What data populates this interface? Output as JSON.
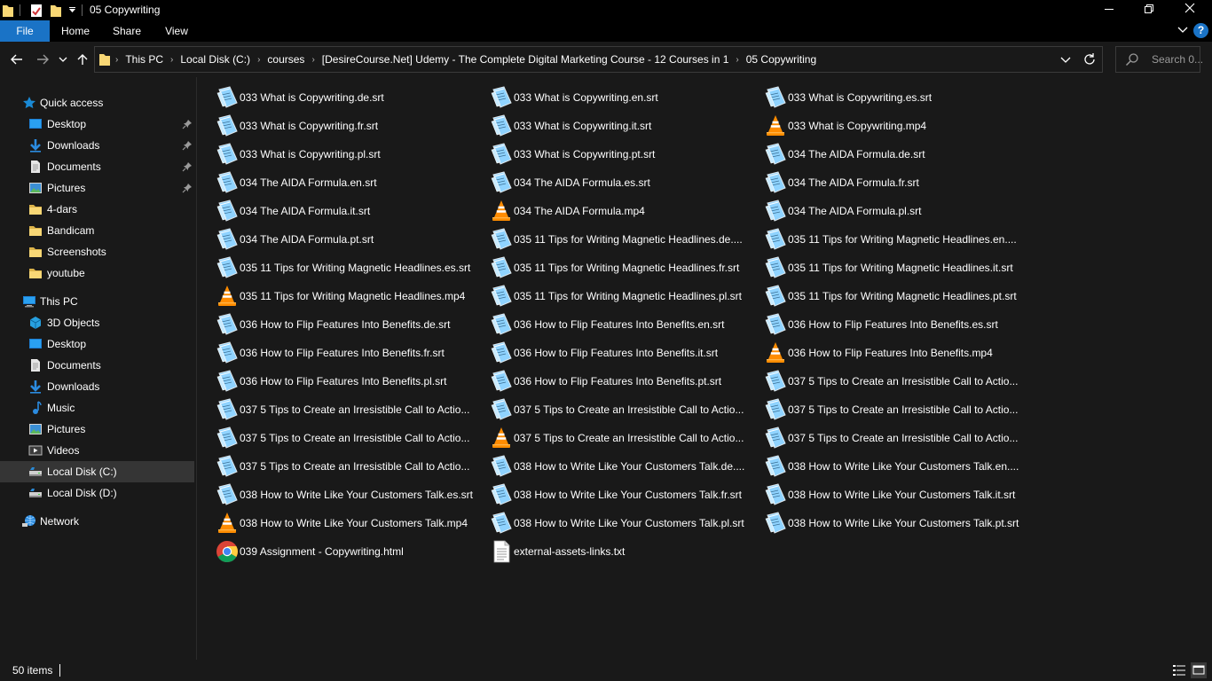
{
  "window": {
    "title": "05 Copywriting"
  },
  "ribbon": {
    "file": "File",
    "home": "Home",
    "share": "Share",
    "view": "View",
    "help": "?"
  },
  "breadcrumbs": [
    "This PC",
    "Local Disk (C:)",
    "courses",
    "[DesireCourse.Net] Udemy - The Complete Digital Marketing Course - 12 Courses in 1",
    "05 Copywriting"
  ],
  "search": {
    "placeholder": "Search 0..."
  },
  "sidebar": {
    "quick_access": {
      "label": "Quick access",
      "items": [
        {
          "label": "Desktop",
          "icon": "desktop-icon",
          "pinned": true
        },
        {
          "label": "Downloads",
          "icon": "download-icon",
          "pinned": true
        },
        {
          "label": "Documents",
          "icon": "document-icon",
          "pinned": true
        },
        {
          "label": "Pictures",
          "icon": "pictures-icon",
          "pinned": true
        },
        {
          "label": "4-dars",
          "icon": "folder-icon",
          "pinned": false
        },
        {
          "label": "Bandicam",
          "icon": "folder-icon",
          "pinned": false
        },
        {
          "label": "Screenshots",
          "icon": "folder-icon",
          "pinned": false
        },
        {
          "label": "youtube",
          "icon": "folder-icon",
          "pinned": false
        }
      ]
    },
    "this_pc": {
      "label": "This PC",
      "items": [
        {
          "label": "3D Objects",
          "icon": "3d-objects-icon"
        },
        {
          "label": "Desktop",
          "icon": "desktop-icon"
        },
        {
          "label": "Documents",
          "icon": "document-icon"
        },
        {
          "label": "Downloads",
          "icon": "download-icon"
        },
        {
          "label": "Music",
          "icon": "music-icon"
        },
        {
          "label": "Pictures",
          "icon": "pictures-icon"
        },
        {
          "label": "Videos",
          "icon": "videos-icon"
        },
        {
          "label": "Local Disk (C:)",
          "icon": "drive-icon",
          "selected": true
        },
        {
          "label": "Local Disk (D:)",
          "icon": "drive-icon"
        }
      ]
    },
    "network": {
      "label": "Network"
    }
  },
  "files": [
    {
      "name": "033 What is Copywriting.de.srt",
      "type": "srt"
    },
    {
      "name": "033 What is Copywriting.en.srt",
      "type": "srt"
    },
    {
      "name": "033 What is Copywriting.es.srt",
      "type": "srt"
    },
    {
      "name": "033 What is Copywriting.fr.srt",
      "type": "srt"
    },
    {
      "name": "033 What is Copywriting.it.srt",
      "type": "srt"
    },
    {
      "name": "033 What is Copywriting.mp4",
      "type": "mp4"
    },
    {
      "name": "033 What is Copywriting.pl.srt",
      "type": "srt"
    },
    {
      "name": "033 What is Copywriting.pt.srt",
      "type": "srt"
    },
    {
      "name": "034 The AIDA Formula.de.srt",
      "type": "srt"
    },
    {
      "name": "034 The AIDA Formula.en.srt",
      "type": "srt"
    },
    {
      "name": "034 The AIDA Formula.es.srt",
      "type": "srt"
    },
    {
      "name": "034 The AIDA Formula.fr.srt",
      "type": "srt"
    },
    {
      "name": "034 The AIDA Formula.it.srt",
      "type": "srt"
    },
    {
      "name": "034 The AIDA Formula.mp4",
      "type": "mp4"
    },
    {
      "name": "034 The AIDA Formula.pl.srt",
      "type": "srt"
    },
    {
      "name": "034 The AIDA Formula.pt.srt",
      "type": "srt"
    },
    {
      "name": "035 11 Tips for Writing Magnetic Headlines.de....",
      "type": "srt"
    },
    {
      "name": "035 11 Tips for Writing Magnetic Headlines.en....",
      "type": "srt"
    },
    {
      "name": "035 11 Tips for Writing Magnetic Headlines.es.srt",
      "type": "srt"
    },
    {
      "name": "035 11 Tips for Writing Magnetic Headlines.fr.srt",
      "type": "srt"
    },
    {
      "name": "035 11 Tips for Writing Magnetic Headlines.it.srt",
      "type": "srt"
    },
    {
      "name": "035 11 Tips for Writing Magnetic Headlines.mp4",
      "type": "mp4"
    },
    {
      "name": "035 11 Tips for Writing Magnetic Headlines.pl.srt",
      "type": "srt"
    },
    {
      "name": "035 11 Tips for Writing Magnetic Headlines.pt.srt",
      "type": "srt"
    },
    {
      "name": "036 How to Flip Features Into Benefits.de.srt",
      "type": "srt"
    },
    {
      "name": "036 How to Flip Features Into Benefits.en.srt",
      "type": "srt"
    },
    {
      "name": "036 How to Flip Features Into Benefits.es.srt",
      "type": "srt"
    },
    {
      "name": "036 How to Flip Features Into Benefits.fr.srt",
      "type": "srt"
    },
    {
      "name": "036 How to Flip Features Into Benefits.it.srt",
      "type": "srt"
    },
    {
      "name": "036 How to Flip Features Into Benefits.mp4",
      "type": "mp4"
    },
    {
      "name": "036 How to Flip Features Into Benefits.pl.srt",
      "type": "srt"
    },
    {
      "name": "036 How to Flip Features Into Benefits.pt.srt",
      "type": "srt"
    },
    {
      "name": "037 5 Tips to Create an Irresistible Call to Actio...",
      "type": "srt"
    },
    {
      "name": "037 5 Tips to Create an Irresistible Call to Actio...",
      "type": "srt"
    },
    {
      "name": "037 5 Tips to Create an Irresistible Call to Actio...",
      "type": "srt"
    },
    {
      "name": "037 5 Tips to Create an Irresistible Call to Actio...",
      "type": "srt"
    },
    {
      "name": "037 5 Tips to Create an Irresistible Call to Actio...",
      "type": "srt"
    },
    {
      "name": "037 5 Tips to Create an Irresistible Call to Actio...",
      "type": "mp4"
    },
    {
      "name": "037 5 Tips to Create an Irresistible Call to Actio...",
      "type": "srt"
    },
    {
      "name": "037 5 Tips to Create an Irresistible Call to Actio...",
      "type": "srt"
    },
    {
      "name": "038 How to Write Like Your Customers Talk.de....",
      "type": "srt"
    },
    {
      "name": "038 How to Write Like Your Customers Talk.en....",
      "type": "srt"
    },
    {
      "name": "038 How to Write Like Your Customers Talk.es.srt",
      "type": "srt"
    },
    {
      "name": "038 How to Write Like Your Customers Talk.fr.srt",
      "type": "srt"
    },
    {
      "name": "038 How to Write Like Your Customers Talk.it.srt",
      "type": "srt"
    },
    {
      "name": "038 How to Write Like Your Customers Talk.mp4",
      "type": "mp4"
    },
    {
      "name": "038 How to Write Like Your Customers Talk.pl.srt",
      "type": "srt"
    },
    {
      "name": "038 How to Write Like Your Customers Talk.pt.srt",
      "type": "srt"
    },
    {
      "name": "039 Assignment - Copywriting.html",
      "type": "html"
    },
    {
      "name": "external-assets-links.txt",
      "type": "txt"
    }
  ],
  "status": {
    "item_count": "50 items"
  },
  "colors": {
    "accent": "#1a73c6",
    "background": "#191919",
    "titlebar": "#000000",
    "selected": "#353535",
    "folder": "#f8d775"
  }
}
